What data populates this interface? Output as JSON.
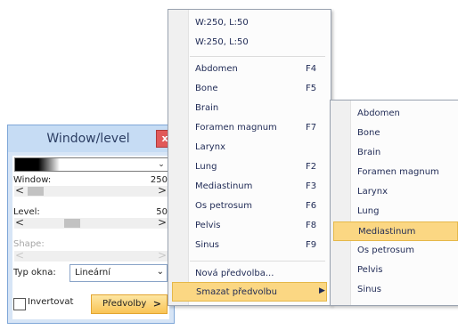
{
  "panel": {
    "title": "Window/level",
    "close_label": "x",
    "window_label": "Window:",
    "window_value": "250",
    "level_label": "Level:",
    "level_value": "50",
    "shape_label": "Shape:",
    "type_label": "Typ okna:",
    "type_value": "Lineární",
    "invert_label": "Invertovat",
    "invert_checked": false,
    "presets_label": "Předvolby",
    "presets_arrow": ">",
    "scroll_left": "<",
    "scroll_right": ">",
    "dropdown_glyph": "⌄"
  },
  "main_menu": {
    "items": [
      {
        "label": "W:250, L:50",
        "shortcut": ""
      },
      {
        "label": "W:250, L:50",
        "shortcut": ""
      },
      {
        "label": "Abdomen",
        "shortcut": "F4"
      },
      {
        "label": "Bone",
        "shortcut": "F5"
      },
      {
        "label": "Brain",
        "shortcut": ""
      },
      {
        "label": "Foramen magnum",
        "shortcut": "F7"
      },
      {
        "label": "Larynx",
        "shortcut": ""
      },
      {
        "label": "Lung",
        "shortcut": "F2"
      },
      {
        "label": "Mediastinum",
        "shortcut": "F3"
      },
      {
        "label": "Os petrosum",
        "shortcut": "F6"
      },
      {
        "label": "Pelvis",
        "shortcut": "F8"
      },
      {
        "label": "Sinus",
        "shortcut": "F9"
      },
      {
        "label": "Nová předvolba...",
        "shortcut": ""
      },
      {
        "label": "Smazat předvolbu",
        "shortcut": ""
      }
    ],
    "submenu_arrow": "▶"
  },
  "sub_menu": {
    "items": [
      "Abdomen",
      "Bone",
      "Brain",
      "Foramen magnum",
      "Larynx",
      "Lung",
      "Mediastinum",
      "Os petrosum",
      "Pelvis",
      "Sinus"
    ]
  },
  "colors": {
    "highlight": "#fbd783",
    "panel_bg": "#d7e5f6",
    "close_button": "#e15a5a",
    "presets_button": "#f9c456"
  }
}
